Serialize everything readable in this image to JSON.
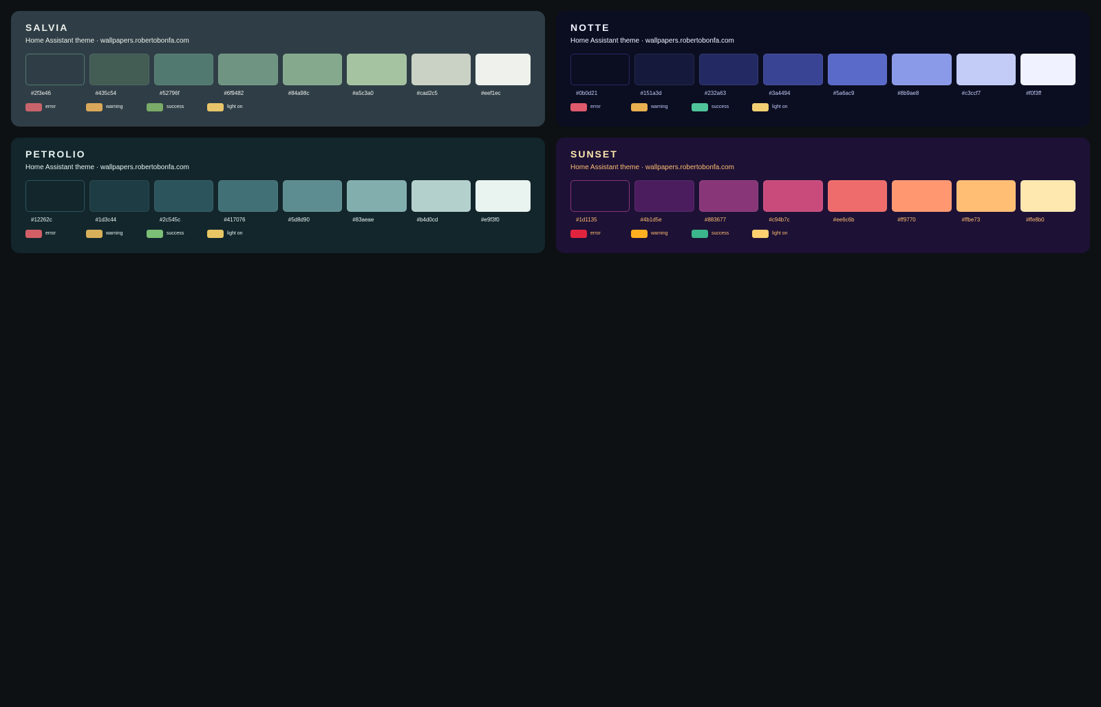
{
  "subtitle_text": "Home Assistant theme · wallpapers.robertobonfa.com",
  "legend_labels": [
    "error",
    "warning",
    "success",
    "light on"
  ],
  "themes": [
    {
      "name": "SALVIA",
      "bg": "#2f3e46",
      "title_color": "#eef1ec",
      "subtitle_color": "#eef1ec",
      "hex_color": "#eef1ec",
      "first_border": "#52796f",
      "swatches": [
        "#2f3e46",
        "#435c54",
        "#52796f",
        "#6f9482",
        "#84a98c",
        "#a5c3a0",
        "#cad2c5",
        "#eef1ec"
      ],
      "legend_colors": [
        "#c9636b",
        "#d9a85a",
        "#7aab68",
        "#e8c56a"
      ]
    },
    {
      "name": "NOTTE",
      "bg": "#0b0d21",
      "title_color": "#f0f3ff",
      "subtitle_color": "#f0f3ff",
      "hex_color": "#c3ccf7",
      "first_border": "#232a63",
      "swatches": [
        "#0b0d21",
        "#151a3d",
        "#232a63",
        "#3a4494",
        "#5a6ac9",
        "#8b9ae8",
        "#c3ccf7",
        "#f0f3ff"
      ],
      "legend_colors": [
        "#e05a6d",
        "#e8b04f",
        "#4fc49a",
        "#f2d072"
      ]
    },
    {
      "name": "PETROLIO",
      "bg": "#12262c",
      "title_color": "#e9f3f0",
      "subtitle_color": "#e9f3f0",
      "hex_color": "#e9f3f0",
      "first_border": "#2c545c",
      "swatches": [
        "#12262c",
        "#1d3c44",
        "#2c545c",
        "#417076",
        "#5d8d90",
        "#83aeae",
        "#b4d0cd",
        "#e9f3f0"
      ],
      "legend_colors": [
        "#d35f66",
        "#d8b05a",
        "#7cbf76",
        "#e9c765"
      ]
    },
    {
      "name": "SUNSET",
      "bg": "#1d1135",
      "title_color": "#ffe8b0",
      "subtitle_color": "#ffbe73",
      "hex_color": "#ffbe73",
      "first_border": "#883677",
      "swatches": [
        "#1d1135",
        "#4b1d5e",
        "#883677",
        "#c94b7c",
        "#ee6c6b",
        "#ff9770",
        "#ffbe73",
        "#ffe8b0"
      ],
      "legend_colors": [
        "#e0243f",
        "#ffb020",
        "#3bb58b",
        "#ffd070"
      ]
    }
  ]
}
